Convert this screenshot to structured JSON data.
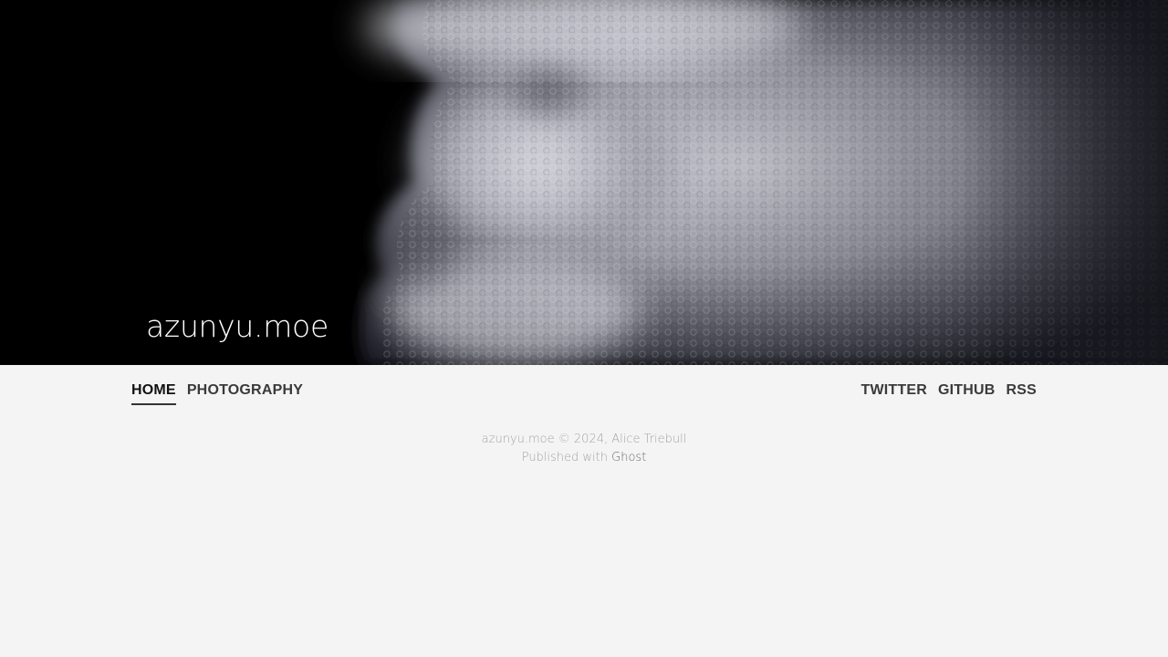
{
  "site": {
    "title": "azunyu.moe"
  },
  "hero": {
    "image": "styrofoam-face-closeup"
  },
  "nav": {
    "primary": [
      {
        "label": "HOME",
        "active": true
      },
      {
        "label": "PHOTOGRAPHY",
        "active": false
      }
    ],
    "secondary": [
      {
        "label": "TWITTER"
      },
      {
        "label": "GITHUB"
      },
      {
        "label": "RSS"
      }
    ]
  },
  "footer": {
    "copyright": "azunyu.moe © 2024, Alice Triebull",
    "published_prefix": "Published with",
    "published_link": "Ghost"
  },
  "colors": {
    "background": "#f4f4f4",
    "nav_text": "#3a3a3a",
    "footer_text": "#a4a4a4"
  }
}
